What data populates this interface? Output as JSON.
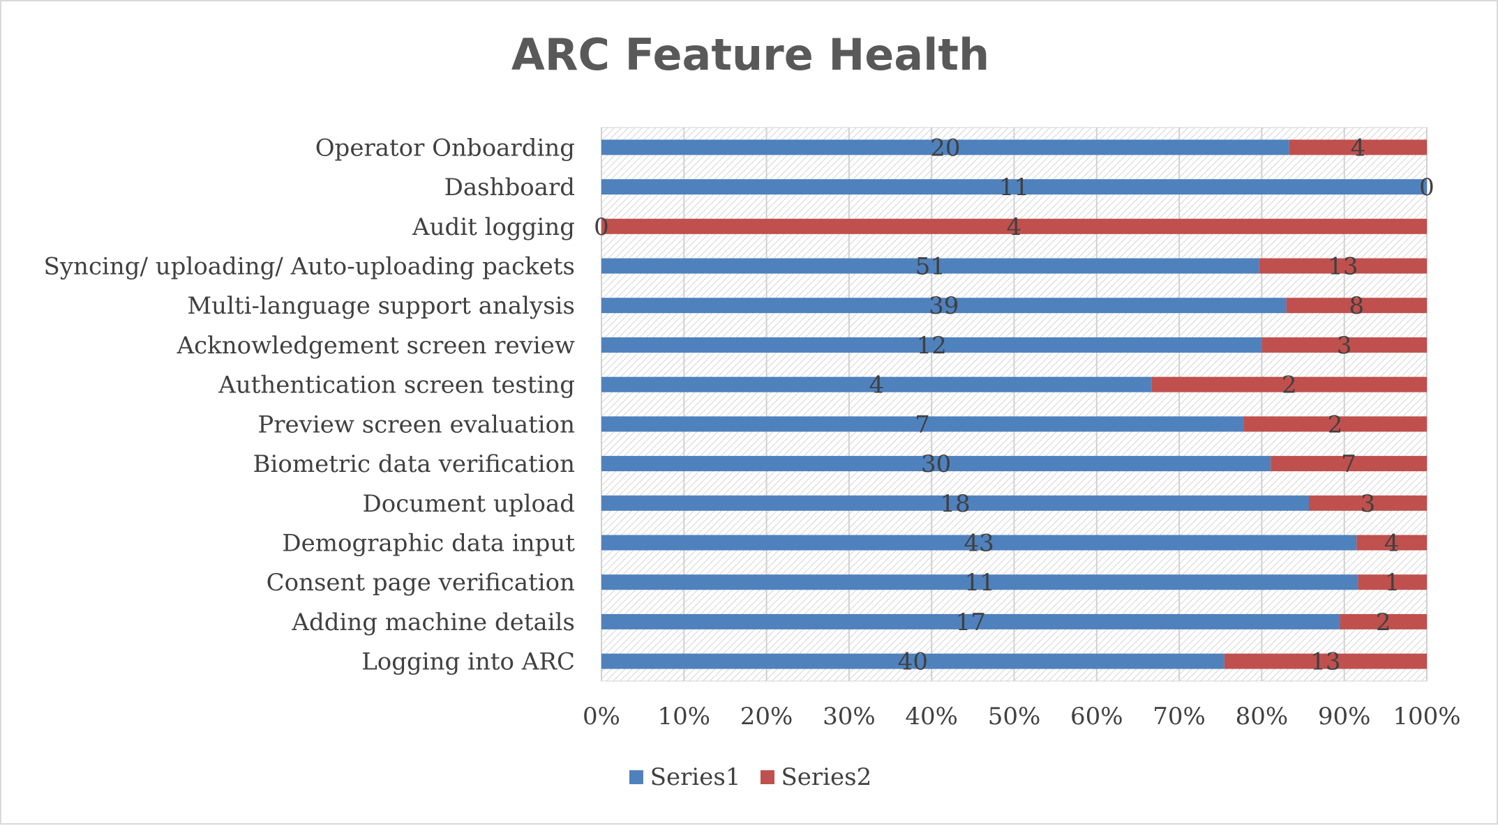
{
  "chart_data": {
    "type": "bar",
    "orientation": "horizontal",
    "stacked": "percent",
    "title": "ARC Feature Health",
    "categories": [
      "Logging into ARC",
      "Adding machine details",
      "Consent page verification",
      "Demographic data input",
      "Document upload",
      "Biometric data verification",
      "Preview screen evaluation",
      "Authentication screen testing",
      "Acknowledgement screen review",
      "Multi-language support analysis",
      "Syncing/ uploading/ Auto-uploading packets",
      "Audit logging",
      "Dashboard",
      "Operator Onboarding"
    ],
    "series": [
      {
        "name": "Series1",
        "color": "#4f81bd",
        "values": [
          40,
          17,
          11,
          43,
          18,
          30,
          7,
          4,
          12,
          39,
          51,
          0,
          11,
          20
        ]
      },
      {
        "name": "Series2",
        "color": "#c0504d",
        "values": [
          13,
          2,
          1,
          4,
          3,
          7,
          2,
          2,
          3,
          8,
          13,
          4,
          0,
          4
        ]
      }
    ],
    "xlim": [
      0,
      100
    ],
    "xticks": [
      "0%",
      "10%",
      "20%",
      "30%",
      "40%",
      "50%",
      "60%",
      "70%",
      "80%",
      "90%",
      "100%"
    ],
    "xlabel": "",
    "ylabel": "",
    "legend": "bottom",
    "grid": true,
    "data_labels": true
  }
}
